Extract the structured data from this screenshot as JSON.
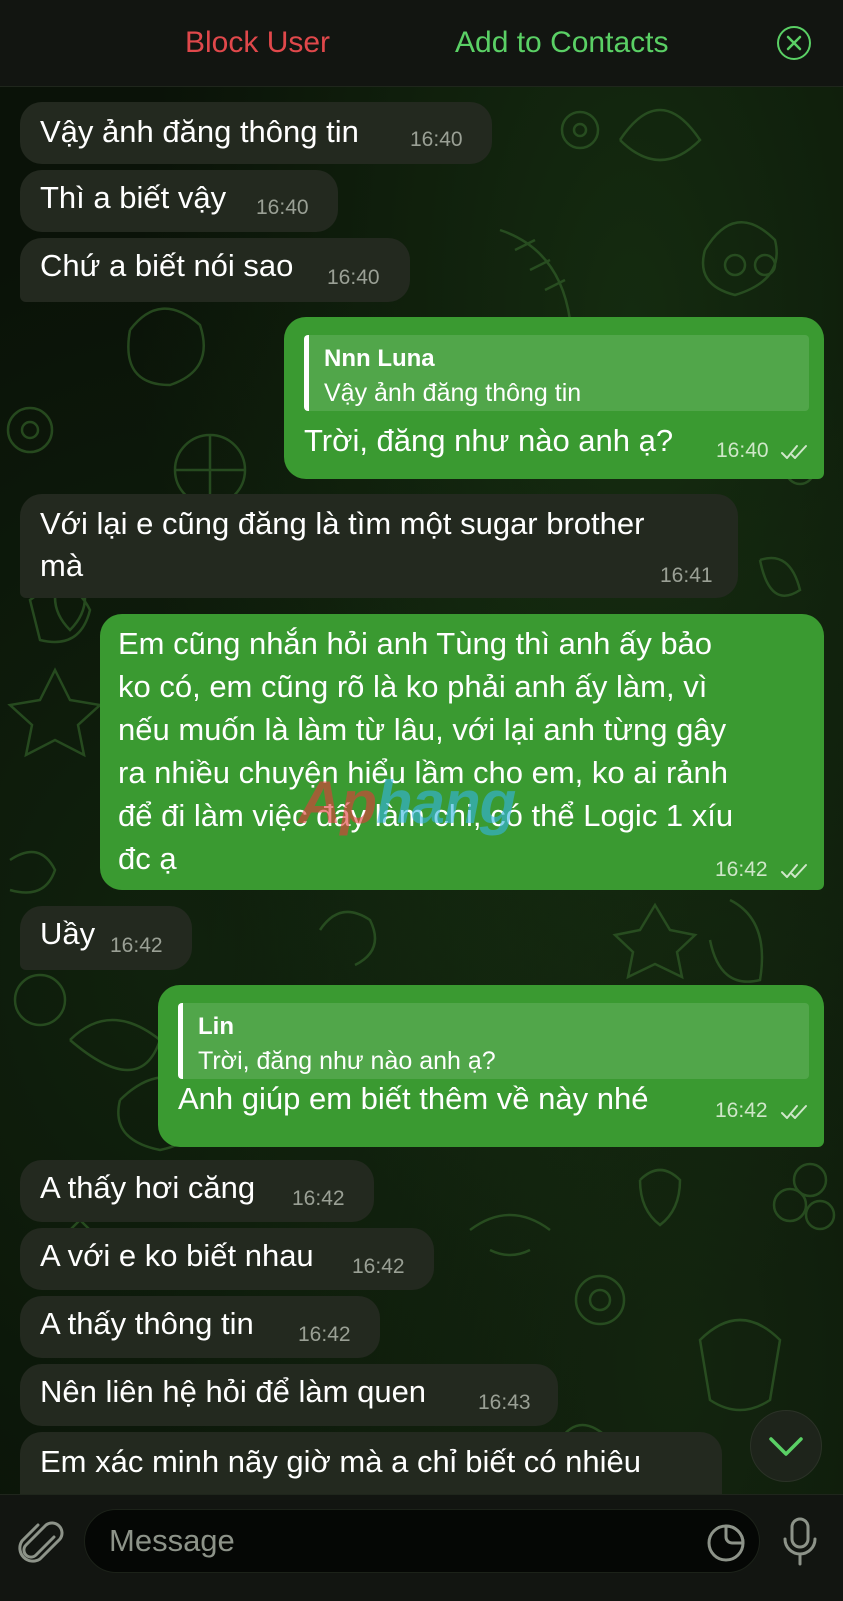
{
  "header": {
    "block_label": "Block User",
    "add_label": "Add to Contacts"
  },
  "messages": [
    {
      "text": "Vậy ảnh đăng thông tin",
      "time": "16:40"
    },
    {
      "text": "Thì a biết vậy",
      "time": "16:40"
    },
    {
      "text": "Chứ a biết nói sao",
      "time": "16:40"
    },
    {
      "reply_name": "Nnn Luna",
      "reply_text": "Vậy ảnh đăng thông tin",
      "text": "Trời, đăng như nào anh ạ?",
      "time": "16:40"
    },
    {
      "lines": [
        "Với lại e cũng đăng là tìm một sugar brother",
        "mà"
      ],
      "time": "16:41"
    },
    {
      "lines": [
        "Em cũng nhắn hỏi anh Tùng thì anh ấy bảo",
        "ko có, em cũng rõ là ko phải anh ấy làm, vì",
        "nếu muốn là làm từ lâu, với lại anh từng gây",
        "ra nhiều chuyện hiểu lầm cho em, ko ai rảnh",
        "để đi làm việc đấy làm chi, có thể Logic 1 xíu",
        "đc ạ"
      ],
      "time": "16:42"
    },
    {
      "text": "Uầy",
      "time": "16:42"
    },
    {
      "reply_name": "Lin",
      "reply_text": "Trời, đăng như nào anh ạ?",
      "text": "Anh giúp em biết thêm về này nhé",
      "time": "16:42"
    },
    {
      "text": "A thấy hơi căng",
      "time": "16:42"
    },
    {
      "text": "A với e ko biết nhau",
      "time": "16:42"
    },
    {
      "text": "A thấy thông tin",
      "time": "16:42"
    },
    {
      "text": "Nên liên hệ hỏi để làm quen",
      "time": "16:43"
    },
    {
      "text": "Em xác minh nãy giờ mà a chỉ biết có nhiêu"
    }
  ],
  "watermark": {
    "part1": "Ap",
    "part2": "hang"
  },
  "composer": {
    "placeholder": "Message"
  },
  "icons": {
    "close": "close-circle-icon",
    "attach": "paperclip-icon",
    "sticker": "sticker-icon",
    "mic": "microphone-icon",
    "scroll": "chevron-down-icon",
    "read": "double-check-icon"
  },
  "colors": {
    "incoming": "#23291f",
    "outgoing": "#3a9a31",
    "block": "#e0484b",
    "add": "#5ad065"
  }
}
